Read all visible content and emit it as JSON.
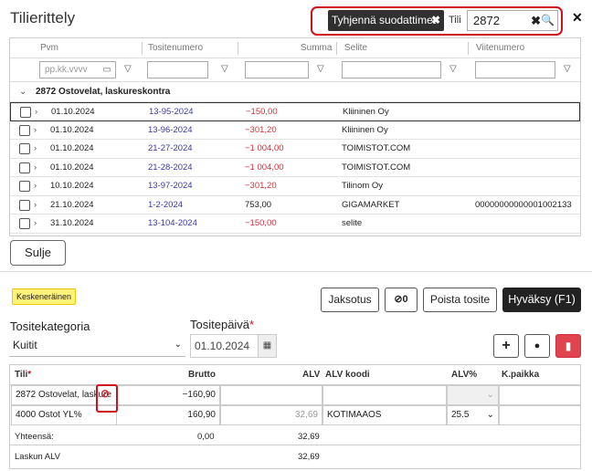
{
  "dialog": {
    "title": "Tilierittely",
    "close_icon": "close-icon"
  },
  "filters": {
    "clear_label": "Tyhjennä suodattimet",
    "account_label": "Tili",
    "account_value": "2872"
  },
  "grid": {
    "columns": [
      "Pvm",
      "Tositenumero",
      "Summa",
      "Selite",
      "Viitenumero"
    ],
    "date_placeholder": "pp.kk.vvvv",
    "group_label": "2872 Ostovelat, laskureskontra",
    "rows": [
      {
        "date": "01.10.2024",
        "voucher": "13-95-2024",
        "sum": "−150,00",
        "desc": "Kliininen Oy",
        "ref": ""
      },
      {
        "date": "01.10.2024",
        "voucher": "13-96-2024",
        "sum": "−301,20",
        "desc": "Kliininen Oy",
        "ref": ""
      },
      {
        "date": "01.10.2024",
        "voucher": "21-27-2024",
        "sum": "−1 004,00",
        "desc": "TOIMISTOT.COM",
        "ref": ""
      },
      {
        "date": "01.10.2024",
        "voucher": "21-28-2024",
        "sum": "−1 004,00",
        "desc": "TOIMISTOT.COM",
        "ref": ""
      },
      {
        "date": "10.10.2024",
        "voucher": "13-97-2024",
        "sum": "−301,20",
        "desc": "Tilinom Oy",
        "ref": ""
      },
      {
        "date": "21.10.2024",
        "voucher": "1-2-2024",
        "sum": "753,00",
        "desc": "GIGAMARKET",
        "ref": "00000000000001002133"
      },
      {
        "date": "31.10.2024",
        "voucher": "13-104-2024",
        "sum": "−150,00",
        "desc": "selite",
        "ref": ""
      }
    ]
  },
  "close_button": "Sulje",
  "editor": {
    "status_badge": "Keskeneräinen",
    "periodize_label": "Jaksotus",
    "attachments_count": "0",
    "delete_voucher_label": "Poista tosite",
    "approve_label": "Hyväksy (F1)",
    "category_label": "Tositekategoria",
    "category_value": "Kuitit",
    "date_label": "Tositepäivä",
    "date_required": "*",
    "date_value": "01.10.2024",
    "table": {
      "headers": [
        "Tili",
        "Brutto",
        "ALV",
        "ALV koodi",
        "ALV%",
        "K.paikka"
      ],
      "required_mark": "*",
      "rows": [
        {
          "account": "2872 Ostovelat, laskure",
          "gross": "−160,90",
          "vat": "",
          "vat_code": "",
          "vat_pct": "",
          "cost_center": ""
        },
        {
          "account": "4000 Ostot YL%",
          "gross": "160,90",
          "vat": "32,69",
          "vat_code": "KOTIMAAOS",
          "vat_pct": "25.5",
          "cost_center": ""
        }
      ],
      "totals": [
        {
          "label": "Yhteensä:",
          "gross": "0,00",
          "vat": "32,69"
        },
        {
          "label": "Laskun ALV",
          "gross": "",
          "vat": "32,69"
        }
      ]
    }
  },
  "colors": {
    "highlight": "#d0101b",
    "negative": "#d0303a",
    "link": "#3a3aa8",
    "badge": "#fff27a",
    "delete_button": "#e0444e"
  }
}
